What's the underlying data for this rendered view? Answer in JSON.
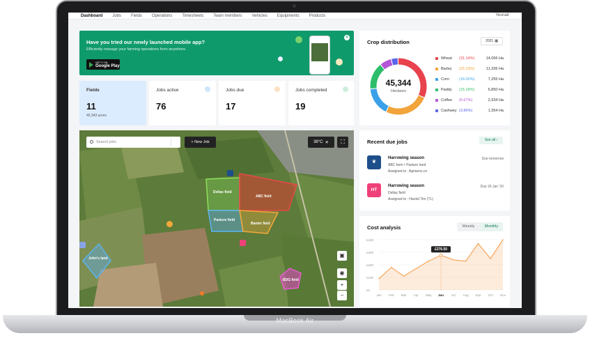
{
  "device": {
    "model": "MacBook Air"
  },
  "nav": {
    "items": [
      "Dashboard",
      "Jobs",
      "Fields",
      "Operations",
      "Timesheets",
      "Team members",
      "Vehicles",
      "Equipments",
      "Products"
    ],
    "active": "Dashboard",
    "user": "Yesnair"
  },
  "promo": {
    "title": "Have you tried our newly launched mobile app?",
    "subtitle": "Efficiently manage your farming operations from anywhere.",
    "store_small": "GET IT ON",
    "store_name": "Google Play"
  },
  "stats": [
    {
      "label": "Fields",
      "value": "11",
      "sub": "45,343 acres"
    },
    {
      "label": "Jobs active",
      "value": "76"
    },
    {
      "label": "Jobs due",
      "value": "17"
    },
    {
      "label": "Jobs completed",
      "value": "19"
    }
  ],
  "map": {
    "search_placeholder": "Search jobs",
    "new_job": "New Job",
    "new_job_icon": "+",
    "temperature": "38°C",
    "fields": [
      "Deltac field",
      "ABC field",
      "Pasture field",
      "Banter field",
      "John's land",
      "BDG field"
    ]
  },
  "crop": {
    "title": "Crop distribution",
    "year": "2021",
    "total": "45,344",
    "unit": "Hectares",
    "items": [
      {
        "name": "Wheat",
        "pct": "(31.14%)",
        "ha": "14,056 Ha",
        "color": "#e8424d",
        "share": 31.14
      },
      {
        "name": "Barley",
        "pct": "(25.23%)",
        "ha": "11,336 Ha",
        "color": "#f2a33a",
        "share": 25.23
      },
      {
        "name": "Corn",
        "pct": "(16.02%)",
        "ha": "7,255 Ha",
        "color": "#3aa0e8",
        "share": 16.02
      },
      {
        "name": "Paddy",
        "pct": "(15.18%)",
        "ha": "6,850 Ha",
        "color": "#2ebd6b",
        "share": 15.18
      },
      {
        "name": "Coffee",
        "pct": "(6.67%)",
        "ha": "2,934 Ha",
        "color": "#b455d6",
        "share": 6.67
      },
      {
        "name": "Cashwey",
        "pct": "(3.86%)",
        "ha": "1,354 Ha",
        "color": "#5a64e8",
        "share": 3.86
      }
    ]
  },
  "jobs": {
    "title": "Recent due jobs",
    "see_all": "See all",
    "items": [
      {
        "avatar": "",
        "title": "Harrowing season",
        "line1": "ABC farm  •  Pasture land",
        "line2": "Assigned to : Agrisens.co",
        "due": "Due tomorrow",
        "color": "#1d4f8a"
      },
      {
        "avatar": "HT",
        "title": "Harrowing season",
        "line1": "Deltac field",
        "line2": "Assigned to : Harold Tim (TL)",
        "due": "Due 26 Jan '20",
        "color": "#f0407a"
      }
    ]
  },
  "cost": {
    "title": "Cost analysis",
    "tabs": [
      "Weekly",
      "Monthly"
    ],
    "active_tab": "Monthly",
    "tooltip": "£276.50"
  },
  "chart_data": {
    "type": "area",
    "categories": [
      "Jan",
      "Feb",
      "Mar",
      "Apr",
      "May",
      "Jun",
      "Jul",
      "Aug",
      "Sep",
      "Oct",
      "Nov"
    ],
    "values": [
      90,
      180,
      110,
      170,
      230,
      276.5,
      240,
      230,
      370,
      250,
      400
    ],
    "ylim": [
      0,
      400
    ],
    "y_ticks": [
      "£400",
      "£300",
      "£200",
      "£100",
      "£0"
    ],
    "highlight_index": 5,
    "color": "#f6a55a"
  }
}
